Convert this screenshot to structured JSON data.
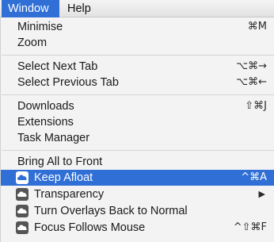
{
  "menubar": {
    "items": [
      {
        "label": "Window"
      },
      {
        "label": "Help"
      }
    ]
  },
  "menu": {
    "minimise": {
      "label": "Minimise",
      "shortcut": "⌘M"
    },
    "zoom": {
      "label": "Zoom"
    },
    "select_next_tab": {
      "label": "Select Next Tab",
      "shortcut": "⌥⌘→"
    },
    "select_previous_tab": {
      "label": "Select Previous Tab",
      "shortcut": "⌥⌘←"
    },
    "downloads": {
      "label": "Downloads",
      "shortcut": "⇧⌘J"
    },
    "extensions": {
      "label": "Extensions"
    },
    "task_manager": {
      "label": "Task Manager"
    },
    "bring_all_to_front": {
      "label": "Bring All to Front"
    },
    "keep_afloat": {
      "label": "Keep Afloat",
      "shortcut": "^⌘A",
      "icon": "cloud-app-icon"
    },
    "transparency": {
      "label": "Transparency",
      "icon": "cloud-app-icon",
      "submenu_icon": "▶"
    },
    "turn_overlays_back": {
      "label": "Turn Overlays Back to Normal",
      "icon": "cloud-app-icon"
    },
    "focus_follows_mouse": {
      "label": "Focus Follows Mouse",
      "shortcut": "^⇧⌘F",
      "icon": "cloud-app-icon"
    }
  },
  "colors": {
    "highlight": "#2f6fd6",
    "menu_background": "#f3f3f3"
  }
}
